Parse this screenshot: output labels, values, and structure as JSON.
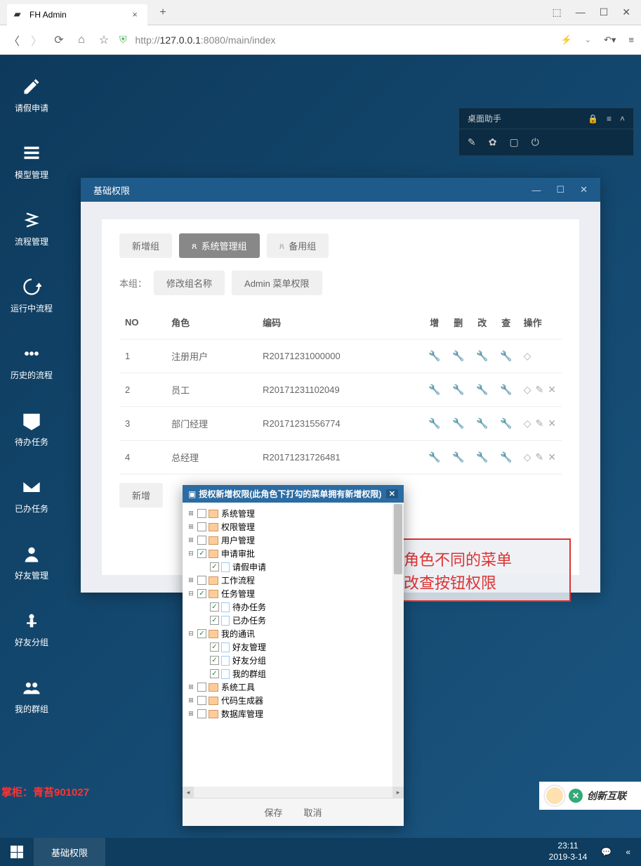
{
  "browser": {
    "tab_title": "FH Admin",
    "url_prefix": "http://",
    "url_host": "127.0.0.1",
    "url_path": ":8080/main/index"
  },
  "desktop_icons": [
    {
      "label": "请假申请"
    },
    {
      "label": "模型管理"
    },
    {
      "label": "流程管理"
    },
    {
      "label": "运行中流程"
    },
    {
      "label": "历史的流程"
    },
    {
      "label": "待办任务"
    },
    {
      "label": "已办任务"
    },
    {
      "label": "好友管理"
    },
    {
      "label": "好友分组"
    },
    {
      "label": "我的群组"
    }
  ],
  "assistant": {
    "title": "桌面助手"
  },
  "window": {
    "title": "基础权限",
    "tabs": {
      "new_group": "新增组",
      "sys_group": "系统管理组",
      "backup_group": "备用组"
    },
    "group_label": "本组：",
    "rename": "修改组名称",
    "admin_menu": "Admin 菜单权限",
    "cols": {
      "no": "NO",
      "role": "角色",
      "code": "编码",
      "add": "增",
      "del": "删",
      "edit": "改",
      "view": "查",
      "op": "操作"
    },
    "rows": [
      {
        "no": "1",
        "role": "注册用户",
        "code": "R20171231000000",
        "has_extra": false
      },
      {
        "no": "2",
        "role": "员工",
        "code": "R20171231102049",
        "has_extra": true
      },
      {
        "no": "3",
        "role": "部门经理",
        "code": "R20171231556774",
        "has_extra": true
      },
      {
        "no": "4",
        "role": "总经理",
        "code": "R20171231726481",
        "has_extra": true
      }
    ],
    "add_label": "新增"
  },
  "tree": {
    "title": "授权新增权限(此角色下打勾的菜单拥有新增权限)",
    "items": [
      {
        "indent": 0,
        "toggle": "+",
        "checked": false,
        "type": "folder",
        "label": "系统管理"
      },
      {
        "indent": 0,
        "toggle": "+",
        "checked": false,
        "type": "folder",
        "label": "权限管理"
      },
      {
        "indent": 0,
        "toggle": "+",
        "checked": false,
        "type": "folder",
        "label": "用户管理"
      },
      {
        "indent": 0,
        "toggle": "−",
        "checked": true,
        "type": "folder",
        "label": "申请审批"
      },
      {
        "indent": 1,
        "toggle": "",
        "checked": true,
        "type": "file",
        "label": "请假申请"
      },
      {
        "indent": 0,
        "toggle": "+",
        "checked": false,
        "type": "folder",
        "label": "工作流程"
      },
      {
        "indent": 0,
        "toggle": "−",
        "checked": true,
        "type": "folder",
        "label": "任务管理"
      },
      {
        "indent": 1,
        "toggle": "",
        "checked": true,
        "type": "file",
        "label": "待办任务"
      },
      {
        "indent": 1,
        "toggle": "",
        "checked": true,
        "type": "file",
        "label": "已办任务"
      },
      {
        "indent": 0,
        "toggle": "−",
        "checked": true,
        "type": "folder",
        "label": "我的通讯"
      },
      {
        "indent": 1,
        "toggle": "",
        "checked": true,
        "type": "file",
        "label": "好友管理"
      },
      {
        "indent": 1,
        "toggle": "",
        "checked": true,
        "type": "file",
        "label": "好友分组"
      },
      {
        "indent": 1,
        "toggle": "",
        "checked": true,
        "type": "file",
        "label": "我的群组"
      },
      {
        "indent": 0,
        "toggle": "+",
        "checked": false,
        "type": "folder",
        "label": "系统工具"
      },
      {
        "indent": 0,
        "toggle": "+",
        "checked": false,
        "type": "folder",
        "label": "代码生成器"
      },
      {
        "indent": 0,
        "toggle": "+",
        "checked": false,
        "type": "folder",
        "label": "数据库管理"
      }
    ],
    "save": "保存",
    "cancel": "取消"
  },
  "annotation": {
    "line1": "授权不同的角色不同的菜单",
    "line2": "不同的增删改查按钮权限"
  },
  "watermark": "掌柜：青苔901027",
  "taskbar": {
    "item": "基础权限",
    "time": "23:11",
    "date": "2019-3-14"
  },
  "corner": {
    "text": "创新互联"
  }
}
